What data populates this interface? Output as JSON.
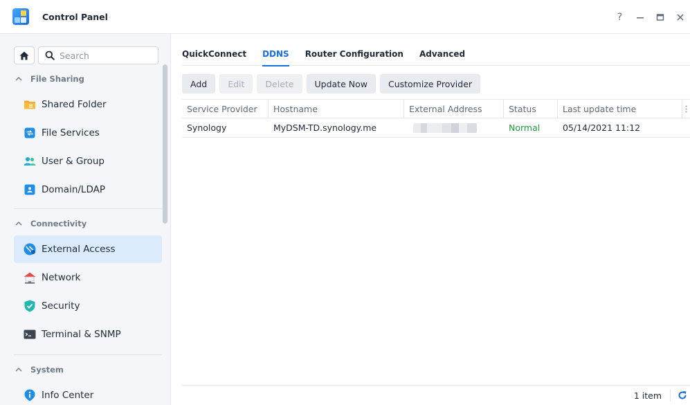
{
  "window": {
    "title": "Control Panel",
    "controls": {
      "help": "?",
      "minimize": "—",
      "close": "X"
    }
  },
  "sidebar": {
    "search": {
      "placeholder": "Search",
      "value": ""
    },
    "sections": [
      {
        "label": "File Sharing",
        "items": [
          {
            "label": "Shared Folder",
            "icon": "shared-folder-icon"
          },
          {
            "label": "File Services",
            "icon": "file-services-icon"
          },
          {
            "label": "User & Group",
            "icon": "user-group-icon"
          },
          {
            "label": "Domain/LDAP",
            "icon": "domain-ldap-icon"
          }
        ]
      },
      {
        "label": "Connectivity",
        "items": [
          {
            "label": "External Access",
            "icon": "external-access-icon",
            "active": true
          },
          {
            "label": "Network",
            "icon": "network-icon"
          },
          {
            "label": "Security",
            "icon": "security-shield-icon"
          },
          {
            "label": "Terminal & SNMP",
            "icon": "terminal-icon"
          }
        ]
      },
      {
        "label": "System",
        "items": [
          {
            "label": "Info Center",
            "icon": "info-center-icon"
          }
        ]
      }
    ]
  },
  "main": {
    "tabs": [
      {
        "label": "QuickConnect",
        "active": false
      },
      {
        "label": "DDNS",
        "active": true
      },
      {
        "label": "Router Configuration",
        "active": false
      },
      {
        "label": "Advanced",
        "active": false
      }
    ],
    "toolbar": {
      "add": "Add",
      "edit": "Edit",
      "delete": "Delete",
      "update_now": "Update Now",
      "customize_provider": "Customize Provider"
    },
    "table": {
      "columns": [
        "Service Provider",
        "Hostname",
        "External Address",
        "Status",
        "Last update time"
      ],
      "rows": [
        {
          "provider": "Synology",
          "hostname": "MyDSM-TD.synology.me",
          "external_address": "",
          "status": "Normal",
          "last_update": "05/14/2021 11:12"
        }
      ]
    },
    "footer": {
      "count": "1 item"
    }
  },
  "colors": {
    "accent": "#1a6ed8",
    "status_normal": "#1c9b3b",
    "active_nav_bg": "#dcebfb"
  }
}
